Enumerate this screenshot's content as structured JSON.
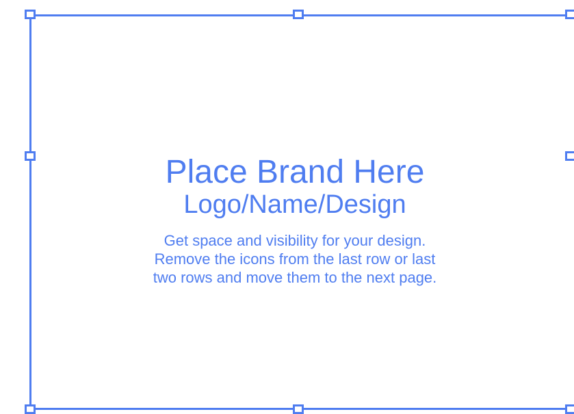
{
  "brand_area": {
    "title": "Place Brand Here",
    "subtitle": "Logo/Name/Design",
    "body_lines": [
      "Get space and visibility for your design.",
      "Remove the icons from the last row or last",
      "two rows and move them to the next page."
    ]
  },
  "colors": {
    "accent": "#4f7df0",
    "background": "#ffffff"
  }
}
